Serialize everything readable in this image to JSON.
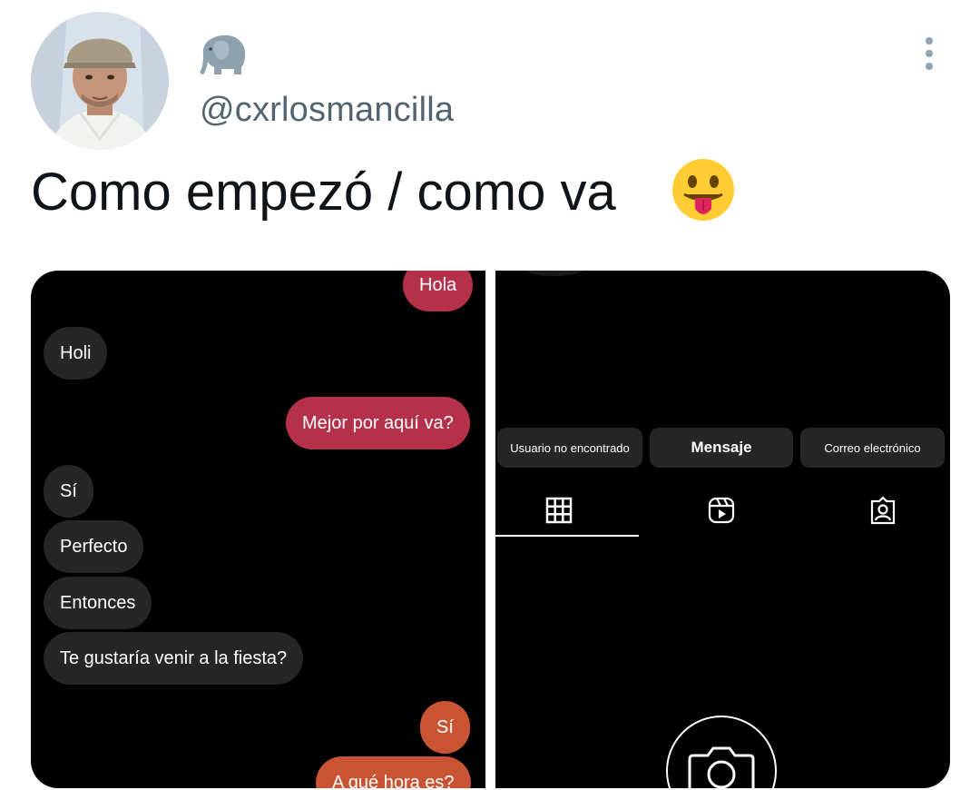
{
  "author": {
    "handle": "@cxrlosmancilla",
    "avatar": "profile-photo",
    "badge_icon": "elephant-emoji"
  },
  "menu_icon": "more-vertical-icon",
  "tweet": {
    "text": "Como empezó / como va",
    "emoji": "face-with-tongue-emoji"
  },
  "left_screenshot": {
    "messages": [
      {
        "text": "Hola",
        "side": "out"
      },
      {
        "text": "Holi",
        "side": "in"
      },
      {
        "text": "Mejor por aquí va?",
        "side": "out"
      },
      {
        "text": "Sí",
        "side": "in"
      },
      {
        "text": "Perfecto",
        "side": "in"
      },
      {
        "text": "Entonces",
        "side": "in"
      },
      {
        "text": "Te gustaría venir a la fiesta?",
        "side": "in"
      },
      {
        "text": "Sí",
        "side": "out"
      },
      {
        "text": "A qué hora es?",
        "side": "out"
      }
    ],
    "colors": {
      "incoming": "#262626",
      "outgoing_red": "#b5314a",
      "outgoing_orange": "#c85433"
    }
  },
  "right_screenshot": {
    "buttons": {
      "user_not_found": "Usuario no encontrado",
      "message": "Mensaje",
      "email": "Correo electrónico"
    },
    "tabs": [
      "grid-icon",
      "reels-icon",
      "tagged-icon"
    ],
    "active_tab": "grid-icon",
    "empty_state_icon": "camera-icon"
  }
}
